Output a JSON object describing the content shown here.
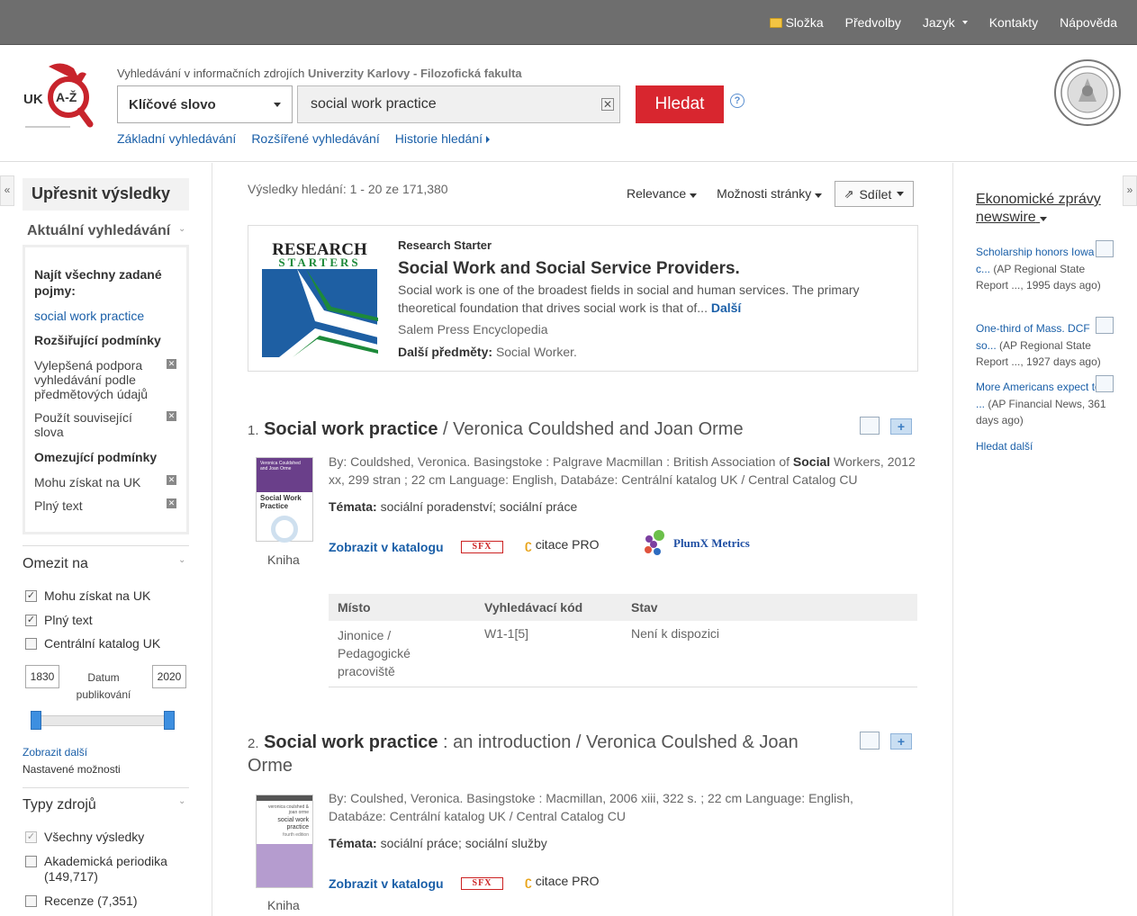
{
  "topbar": {
    "items": [
      {
        "label": "Složka"
      },
      {
        "label": "Předvolby"
      },
      {
        "label": "Jazyk"
      },
      {
        "label": "Kontakty"
      },
      {
        "label": "Nápověda"
      }
    ]
  },
  "header": {
    "logo_text": "UK A-Ž",
    "headline_prefix": "Vyhledávání v informačních zdrojích",
    "headline_bold": "Univerzity Karlovy - Filozofická fakulta",
    "field_select": "Klíčové slovo",
    "search_value": "social work practice",
    "search_button": "Hledat",
    "help": "?",
    "links": [
      "Základní vyhledávání",
      "Rozšířené vyhledávání",
      "Historie hledání"
    ]
  },
  "left": {
    "title": "Upřesnit výsledky",
    "current_search": "Aktuální vyhledávání",
    "find_all": "Najít všechny zadané pojmy:",
    "query": "social work practice",
    "expanders_head": "Rozšiřující podmínky",
    "expanders": [
      "Vylepšená podpora vyhledávání podle předmětových údajů",
      "Použít související slova"
    ],
    "limiters_head": "Omezující podmínky",
    "limiters": [
      "Mohu získat na UK",
      "Plný text"
    ],
    "limit_to": "Omezit na",
    "limit_options": [
      {
        "label": "Mohu získat na UK",
        "checked": true
      },
      {
        "label": "Plný text",
        "checked": true
      },
      {
        "label": "Centrální katalog UK",
        "checked": false
      }
    ],
    "year_from": "1830",
    "year_to": "2020",
    "date_label": "Datum publikování",
    "show_more": "Zobrazit další",
    "set_options": "Nastavené možnosti",
    "source_types": "Typy zdrojů",
    "source_options": [
      {
        "label": "Všechny výsledky",
        "checked": true
      },
      {
        "label": "Akademická periodika (149,717)",
        "checked": false
      },
      {
        "label": "Recenze (7,351)",
        "checked": false
      }
    ]
  },
  "center": {
    "results_count": "Výsledky hledání: 1 - 20 ze 171,380",
    "sort": "Relevance",
    "page_options": "Možnosti stránky",
    "share": "Sdílet",
    "research_starter": {
      "logo_line1": "RESEARCH",
      "logo_line2": "STARTERS",
      "label": "Research Starter",
      "title": "Social Work and Social Service Providers.",
      "text": "Social work is one of the broadest fields in social and human services. The primary theoretical foundation that drives social work is that of...",
      "more": "Další",
      "source": "Salem Press Encyclopedia",
      "subjects_label": "Další předměty:",
      "subjects": "Social Worker."
    },
    "results": [
      {
        "num": "1.",
        "title_bold": "Social work practice",
        "title_rest": " / Veronica Couldshed and Joan Orme",
        "cover_line1": "Veronica Couldshed and Joan Orme",
        "cover_line2": "Social Work Practice",
        "type": "Kniha",
        "meta_pre": "By: Couldshed, Veronica. Basingstoke : Palgrave Macmillan : British Association of ",
        "meta_bold": "Social",
        "meta_post": " Workers, 2012 xx, 299 stran ; 22 cm Language: English, Databáze: Centrální katalog UK / Central Catalog CU",
        "topics_label": "Témata:",
        "topics": " sociální poradenství; sociální práce",
        "catalog_link": "Zobrazit v katalogu",
        "sfx": "SFX",
        "citace": "citace PRO",
        "plumx": "PlumX Metrics",
        "holdings_head": [
          "Místo",
          "Vyhledávací kód",
          "Stav"
        ],
        "holdings": [
          [
            "Jinonice / Pedagogické pracoviště",
            "W1-1[5]",
            "Není k dispozici"
          ]
        ]
      },
      {
        "num": "2.",
        "title_bold": "Social work practice",
        "title_rest": " : an introduction / Veronica Coulshed & Joan Orme",
        "cover_line1": "veronica coulshed & joan orme",
        "cover_line2": "social work practice",
        "cover_line3": "fourth edition",
        "type": "Kniha",
        "meta": "By: Coulshed, Veronica. Basingstoke : Macmillan, 2006 xiii, 322 s. ; 22 cm Language: English, Databáze: Centrální katalog UK / Central Catalog CU",
        "topics_label": "Témata:",
        "topics": " sociální práce; sociální služby",
        "catalog_link": "Zobrazit v katalogu",
        "sfx": "SFX",
        "citace": "citace PRO"
      }
    ]
  },
  "right": {
    "title": "Ekonomické zprávy newswire",
    "items": [
      {
        "link": "Scholarship honors Iowa c...",
        "rest": " (AP Regional State Report ..., 1995 days ago)"
      },
      {
        "link": "One-third of Mass. DCF so...",
        "rest": " (AP Regional State Report ..., 1927 days ago)"
      },
      {
        "link": "More Americans expect to ...",
        "rest": " (AP Financial News, 361 days ago)"
      }
    ],
    "more": "Hledat další"
  },
  "colors": {
    "topbar": "#6e6e6e",
    "search_button": "#d8262f",
    "link": "#1a5fa8"
  }
}
